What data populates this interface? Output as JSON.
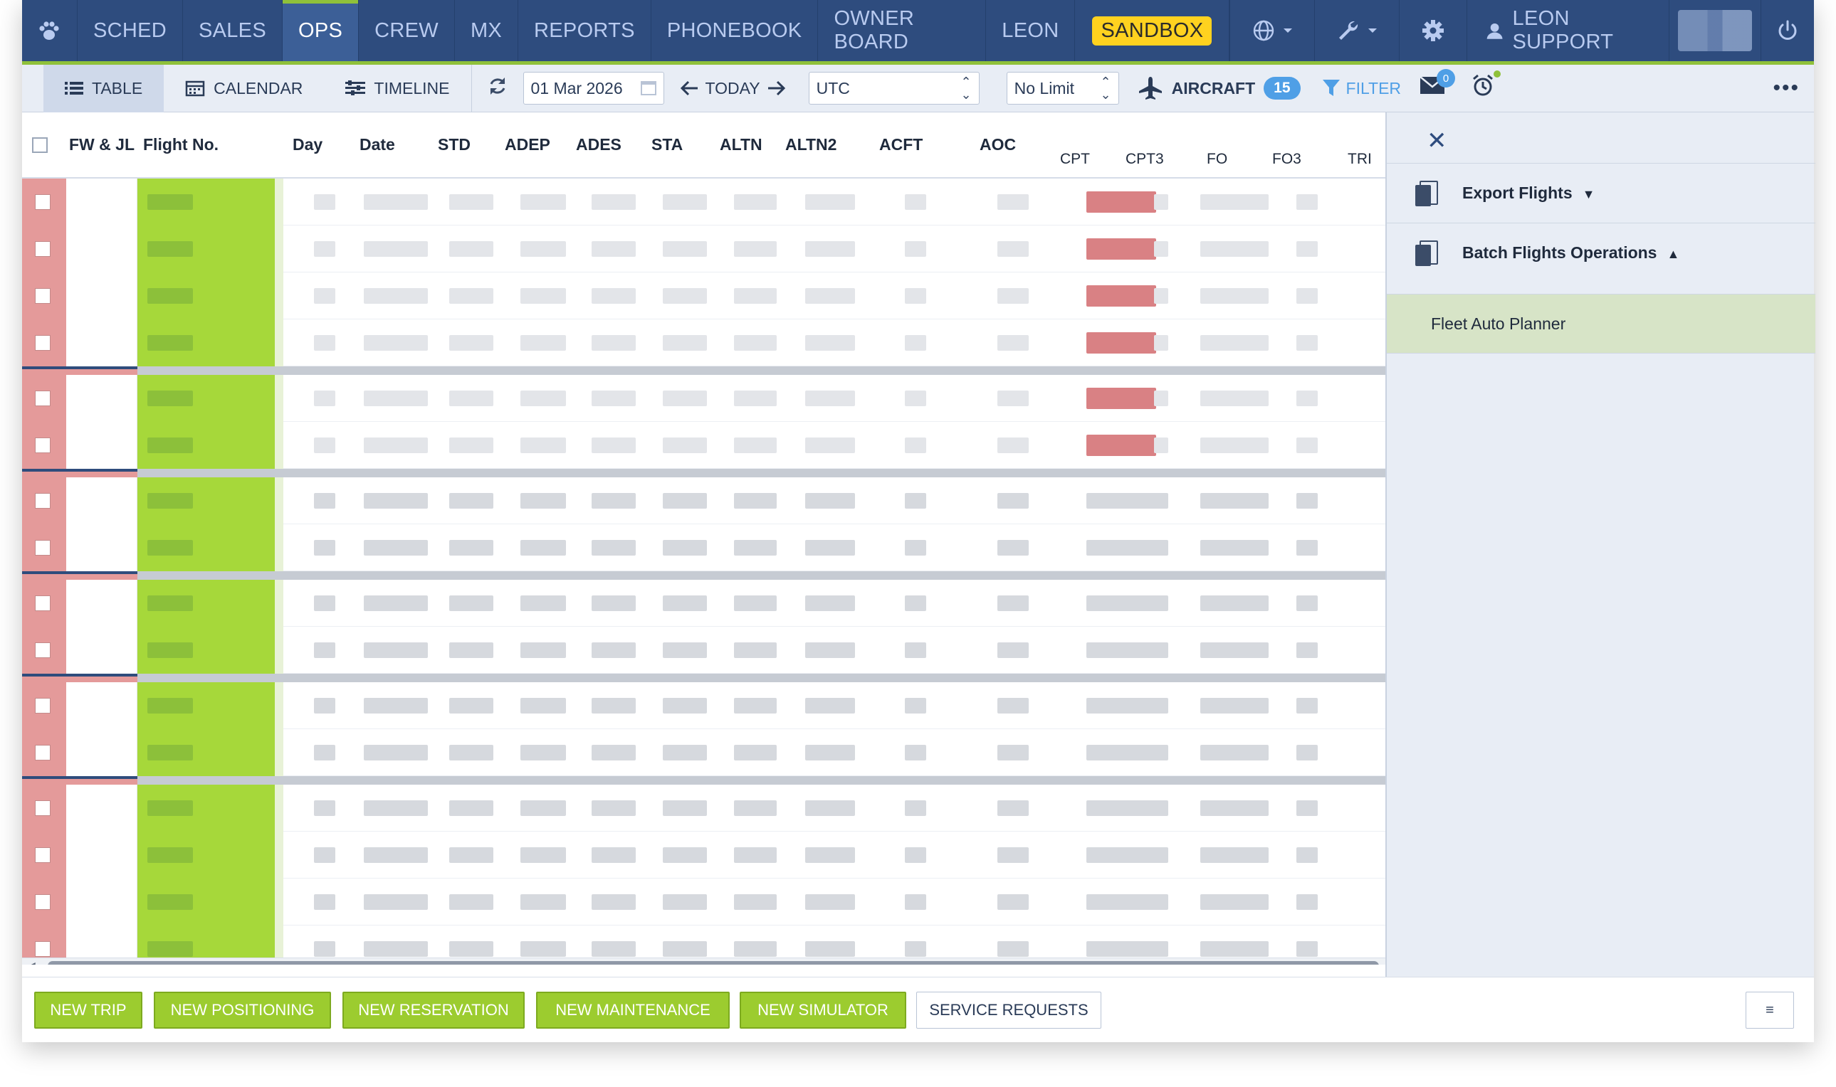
{
  "nav": {
    "items": [
      {
        "label": "SCHED",
        "active": false
      },
      {
        "label": "SALES",
        "active": false
      },
      {
        "label": "OPS",
        "active": true
      },
      {
        "label": "CREW",
        "active": false
      },
      {
        "label": "MX",
        "active": false
      },
      {
        "label": "REPORTS",
        "active": false
      },
      {
        "label": "PHONEBOOK",
        "active": false
      },
      {
        "label": "OWNER BOARD",
        "active": false
      },
      {
        "label": "LEON",
        "active": false
      }
    ],
    "sandbox": "SANDBOX",
    "user": "LEON SUPPORT",
    "icons": [
      "paw-logo-icon",
      "globe-icon",
      "wrench-icon",
      "gear-icon",
      "user-icon",
      "power-icon"
    ]
  },
  "toolbar": {
    "views": [
      {
        "label": "TABLE",
        "icon": "list-icon",
        "active": true
      },
      {
        "label": "CALENDAR",
        "icon": "calendar-icon",
        "active": false
      },
      {
        "label": "TIMELINE",
        "icon": "timeline-icon",
        "active": false
      }
    ],
    "date": "01 Mar 2026",
    "today": "TODAY",
    "timezone": "UTC",
    "limit": "No Limit",
    "aircraft_label": "AIRCRAFT",
    "aircraft_count": "15",
    "filter_label": "FILTER",
    "mail_count": "0",
    "more": "•••"
  },
  "table": {
    "headers": [
      "FW & JL",
      "Flight No.",
      "Day",
      "Date",
      "STD",
      "ADEP",
      "ADES",
      "STA",
      "ALTN",
      "ALTN2",
      "ACFT",
      "AOC"
    ],
    "subheaders": [
      "CPT",
      "CPT3",
      "FO",
      "FO3",
      "TRI"
    ]
  },
  "panel": {
    "close": "✕",
    "items": [
      {
        "label": "Export Flights",
        "caret": "▼"
      },
      {
        "label": "Batch Flights Operations",
        "caret": "▲"
      }
    ],
    "fleet": "Fleet Auto Planner"
  },
  "bottom": {
    "buttons": [
      "NEW TRIP",
      "NEW POSITIONING",
      "NEW RESERVATION",
      "NEW MAINTENANCE",
      "NEW SIMULATOR"
    ],
    "service": "SERVICE REQUESTS",
    "menu": "≡"
  },
  "colors": {
    "nav_bg": "#2e4c7e",
    "accent_green": "#8fc13a",
    "flight_green": "#a6d83a",
    "sandbox_yellow": "#ffd21f",
    "row_red": "#e49a9a",
    "badge_blue": "#4f9fe6"
  }
}
